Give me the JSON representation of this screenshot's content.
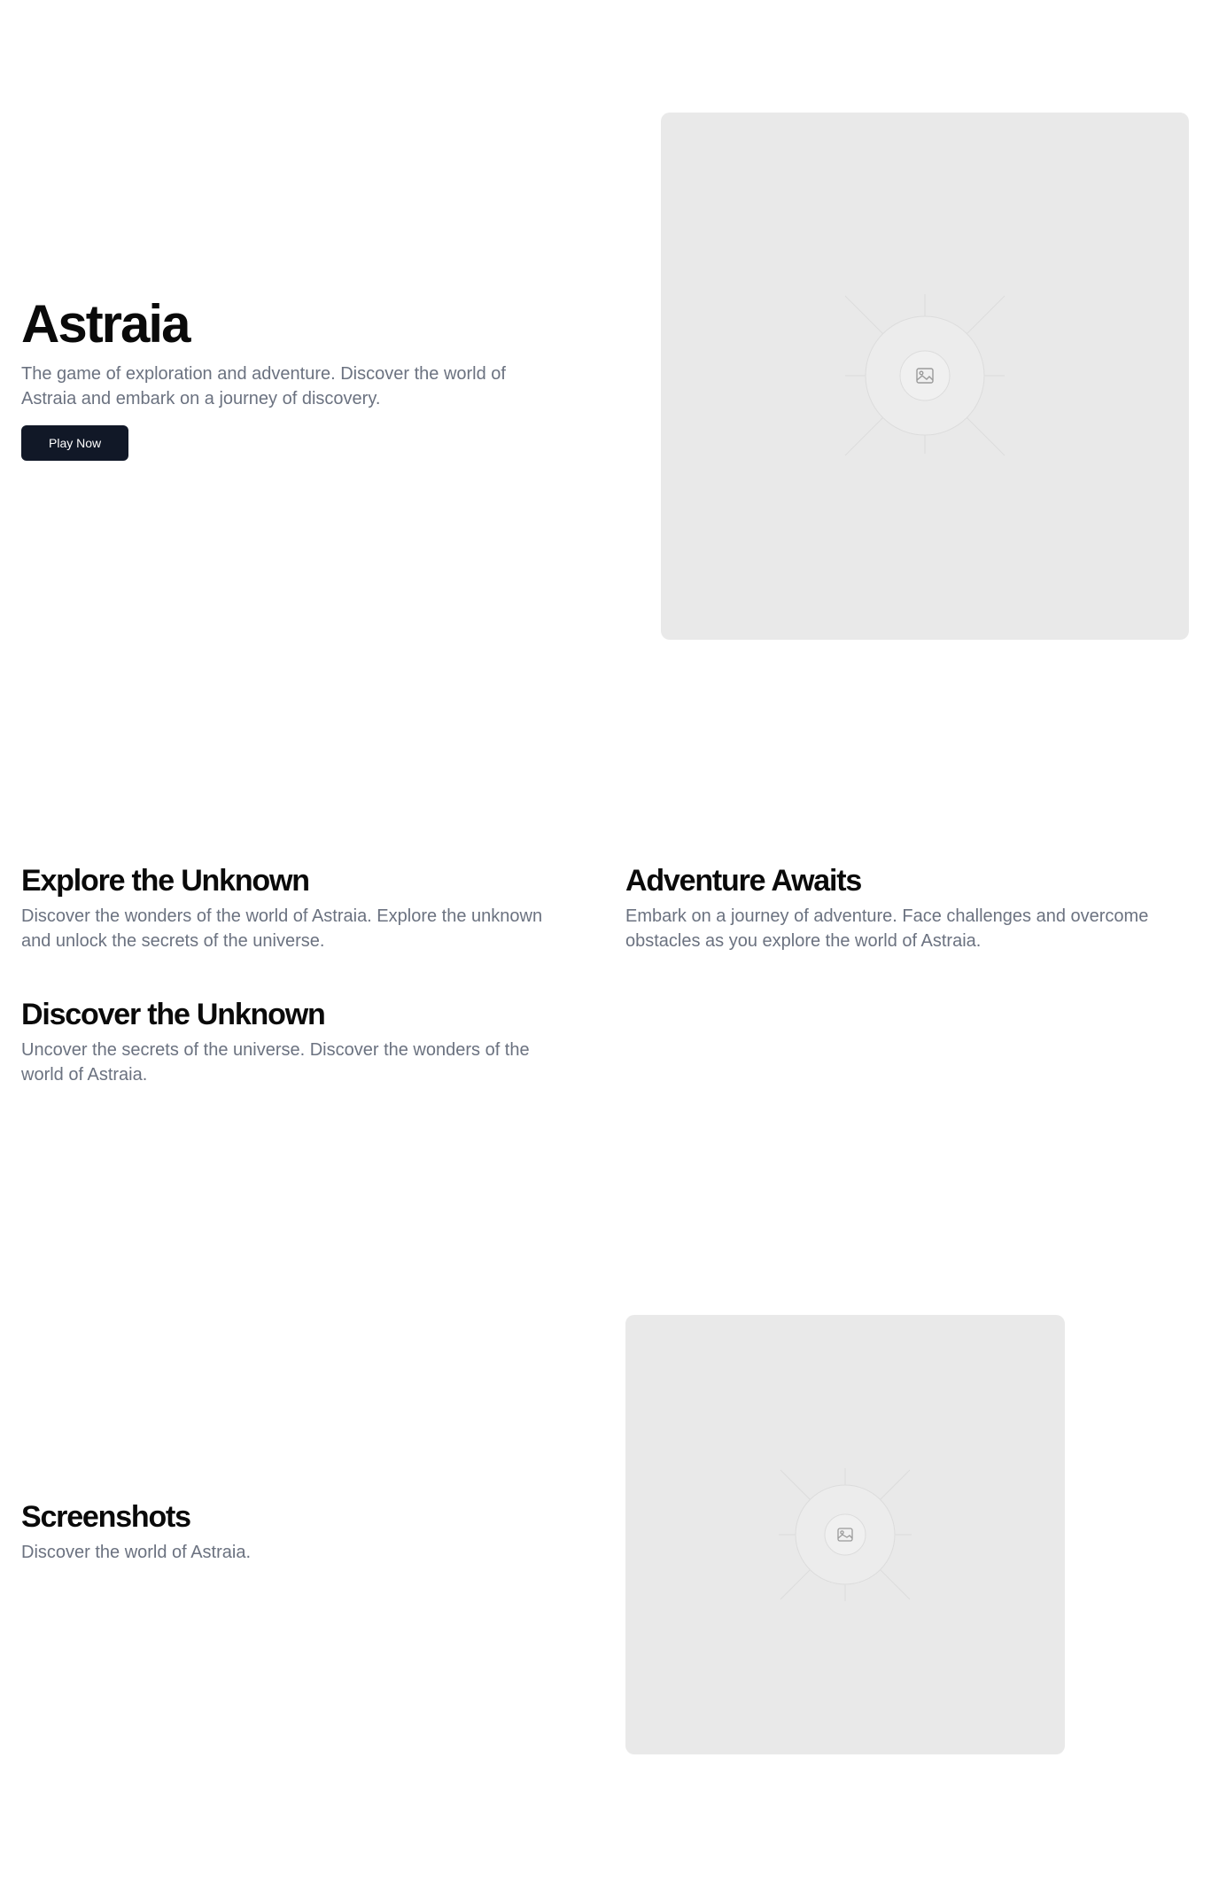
{
  "hero": {
    "title": "Astraia",
    "description": "The game of exploration and adventure. Discover the world of Astraia and embark on a journey of discovery.",
    "cta_label": "Play Now",
    "image_icon": "image-icon"
  },
  "features": [
    {
      "title": "Explore the Unknown",
      "description": "Discover the wonders of the world of Astraia. Explore the unknown and unlock the secrets of the universe."
    },
    {
      "title": "Adventure Awaits",
      "description": "Embark on a journey of adventure. Face challenges and overcome obstacles as you explore the world of Astraia."
    },
    {
      "title": "Discover the Unknown",
      "description": "Uncover the secrets of the universe. Discover the wonders of the world of Astraia."
    }
  ],
  "screenshots": {
    "title": "Screenshots",
    "description": "Discover the world of Astraia.",
    "image_icon": "image-icon"
  },
  "colors": {
    "button_bg": "#111827",
    "muted_text": "#6b7280",
    "placeholder_bg": "#e9e9e9"
  }
}
